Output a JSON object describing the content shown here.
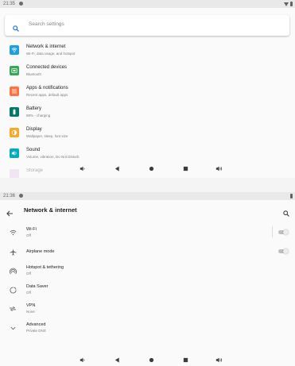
{
  "colors": {
    "network": "#1ba1e2",
    "connected": "#34a853",
    "apps": "#ff7043",
    "battery": "#00796b",
    "display": "#f9a825",
    "sound": "#00acc1",
    "storage": "#e1bee7",
    "search_accent": "#1a73e8"
  },
  "screen1": {
    "status": {
      "time": "21:35"
    },
    "search": {
      "placeholder": "Search settings"
    },
    "items": [
      {
        "title": "Network & internet",
        "subtitle": "Wi-Fi, data usage, and hotspot",
        "icon": "wifi-icon"
      },
      {
        "title": "Connected devices",
        "subtitle": "Bluetooth",
        "icon": "devices-icon"
      },
      {
        "title": "Apps & notifications",
        "subtitle": "Recent apps, default apps",
        "icon": "apps-icon"
      },
      {
        "title": "Battery",
        "subtitle": "88% - charging",
        "icon": "battery-icon"
      },
      {
        "title": "Display",
        "subtitle": "Wallpaper, sleep, font size",
        "icon": "display-icon"
      },
      {
        "title": "Sound",
        "subtitle": "Volume, vibration, Do Not Disturb",
        "icon": "sound-icon"
      },
      {
        "title": "Storage",
        "subtitle": "",
        "icon": "storage-icon"
      }
    ]
  },
  "screen2": {
    "status": {
      "time": "21:36"
    },
    "title": "Network & internet",
    "rows": [
      {
        "title": "Wi-Fi",
        "subtitle": "Off",
        "icon": "wifi-icon"
      },
      {
        "title": "Airplane mode",
        "subtitle": "",
        "icon": "airplane-icon"
      },
      {
        "title": "Hotspot & tethering",
        "subtitle": "Off",
        "icon": "hotspot-icon"
      },
      {
        "title": "Data Saver",
        "subtitle": "Off",
        "icon": "data-saver-icon"
      },
      {
        "title": "VPN",
        "subtitle": "None",
        "icon": "vpn-icon"
      },
      {
        "title": "Advanced",
        "subtitle": "Private DNS",
        "icon": "chevron-down-icon"
      }
    ]
  }
}
